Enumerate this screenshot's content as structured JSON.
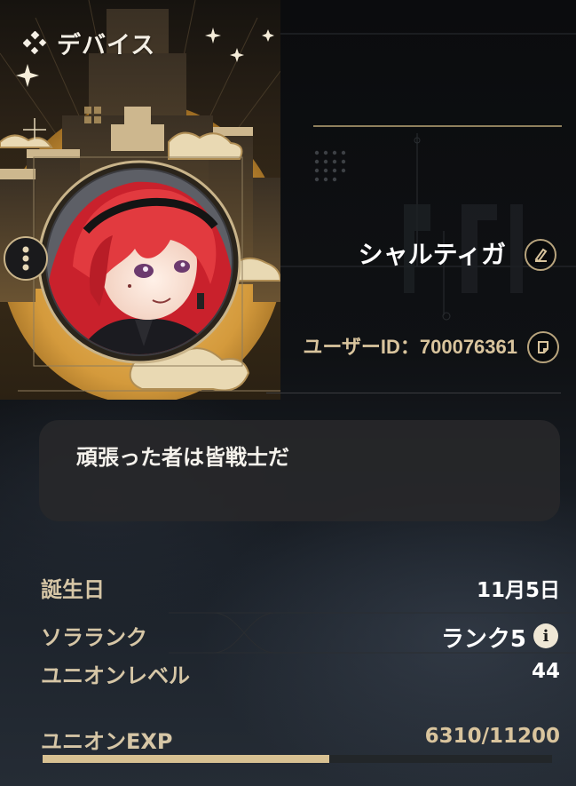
{
  "header": {
    "device_label": "デバイス",
    "device_icon": "diamond-cluster-icon"
  },
  "profile": {
    "name": "シャルティガ",
    "user_id_label": "ユーザーID：",
    "user_id": "700076361",
    "signature": "頑張った者は皆戦士だ"
  },
  "stats": {
    "birthday_label": "誕生日",
    "birthday_value": "11月5日",
    "rank_label": "ソラランク",
    "rank_value": "ランク5",
    "union_level_label": "ユニオンレベル",
    "union_level_value": "44",
    "union_exp_label": "ユニオンEXP",
    "union_exp_value": "6310/11200",
    "union_exp_progress": 0.5634
  },
  "colors": {
    "accent_gold": "#d8c192",
    "label_gold": "#d6c6a6",
    "panel": "#28282a"
  }
}
